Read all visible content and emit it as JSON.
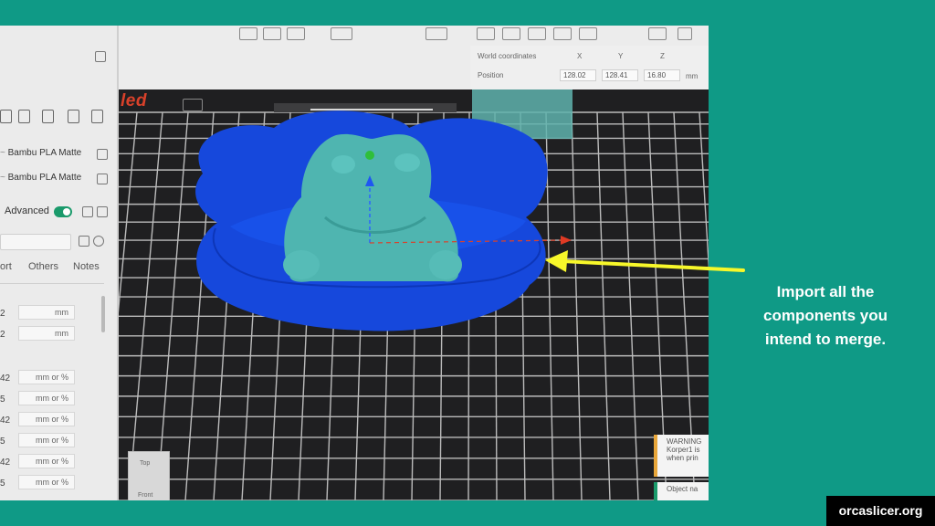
{
  "sidebar": {
    "filaments": [
      {
        "label": "Bambu PLA Matte"
      },
      {
        "label": "Bambu PLA Matte"
      }
    ],
    "advanced_label": "Advanced",
    "tabs": [
      "ort",
      "Others",
      "Notes"
    ],
    "params": [
      {
        "value": "2",
        "unit": "mm"
      },
      {
        "value": "2",
        "unit": "mm"
      },
      {
        "value": "42",
        "unit": "mm or %"
      },
      {
        "value": "5",
        "unit": "mm or %"
      },
      {
        "value": "42",
        "unit": "mm or %"
      },
      {
        "value": "5",
        "unit": "mm or %"
      },
      {
        "value": "42",
        "unit": "mm or %"
      },
      {
        "value": "5",
        "unit": "mm or %"
      }
    ]
  },
  "logo_fragment": "led",
  "coordinates": {
    "label": "World coordinates",
    "axes": [
      "X",
      "Y",
      "Z"
    ],
    "position_label": "Position",
    "x": "128.02",
    "y": "128.41",
    "z": "16.80",
    "unit": "mm"
  },
  "nav_cube": {
    "top": "Top",
    "front": "Front"
  },
  "notices": {
    "warning_title": "WARNING",
    "warning_line1": "Korper1 is",
    "warning_line2": "when prin",
    "info": "Object na"
  },
  "caption": {
    "line1": "Import all the",
    "line2": "components you",
    "line3": "intend to merge."
  },
  "badge": "orcaslicer.org",
  "colors": {
    "background": "#0f9a86",
    "bowl": "#1446d8",
    "frog": "#4fb5b0",
    "arrow": "#f7f72a",
    "badge": "#000000"
  }
}
